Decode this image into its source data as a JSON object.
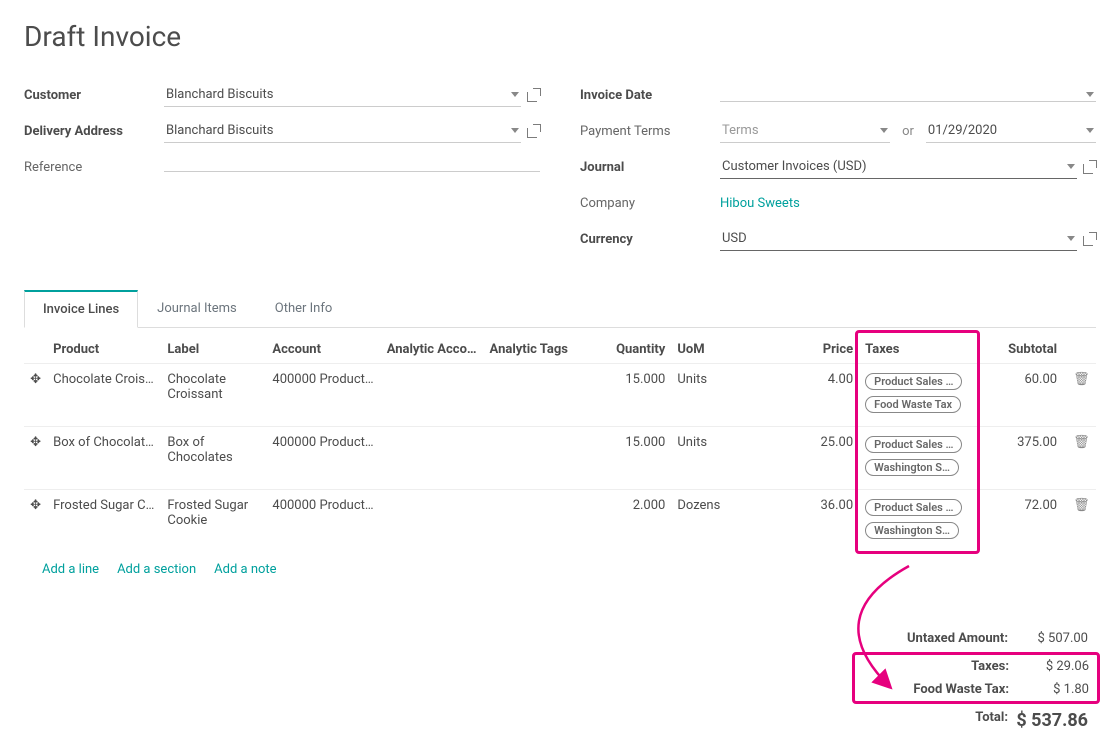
{
  "title": "Draft Invoice",
  "labels": {
    "customer": "Customer",
    "delivery": "Delivery Address",
    "reference": "Reference",
    "invoice_date": "Invoice Date",
    "payment_terms": "Payment Terms",
    "journal": "Journal",
    "company": "Company",
    "currency": "Currency",
    "or": "or"
  },
  "form": {
    "customer": "Blanchard Biscuits",
    "delivery": "Blanchard Biscuits",
    "reference": "",
    "invoice_date": "",
    "terms_placeholder": "Terms",
    "due_date": "01/29/2020",
    "journal": "Customer Invoices (USD)",
    "company": "Hibou Sweets",
    "currency": "USD"
  },
  "tabs": {
    "lines": "Invoice Lines",
    "journal": "Journal Items",
    "other": "Other Info"
  },
  "columns": {
    "product": "Product",
    "label": "Label",
    "account": "Account",
    "analytic_account": "Analytic Acco…",
    "analytic_tags": "Analytic Tags",
    "quantity": "Quantity",
    "uom": "UoM",
    "price": "Price",
    "taxes": "Taxes",
    "subtotal": "Subtotal"
  },
  "lines": [
    {
      "product": "Chocolate Crois…",
      "label": "Chocolate Croissant",
      "account": "400000 Product…",
      "quantity": "15.000",
      "uom": "Units",
      "price": "4.00",
      "taxes": [
        "Product Sales …",
        "Food Waste Tax"
      ],
      "subtotal": "60.00"
    },
    {
      "product": "Box of Chocolat…",
      "label": "Box of Chocolates",
      "account": "400000 Product…",
      "quantity": "15.000",
      "uom": "Units",
      "price": "25.00",
      "taxes": [
        "Product Sales …",
        "Washington S…"
      ],
      "subtotal": "375.00"
    },
    {
      "product": "Frosted Sugar C…",
      "label": "Frosted Sugar Cookie",
      "account": "400000 Product…",
      "quantity": "2.000",
      "uom": "Dozens",
      "price": "36.00",
      "taxes": [
        "Product Sales …",
        "Washington S…"
      ],
      "subtotal": "72.00"
    }
  ],
  "actions": {
    "add_line": "Add a line",
    "add_section": "Add a section",
    "add_note": "Add a note"
  },
  "totals": {
    "untaxed_label": "Untaxed Amount:",
    "untaxed_value": "$ 507.00",
    "taxes_label": "Taxes:",
    "taxes_value": "$ 29.06",
    "food_waste_label": "Food Waste Tax:",
    "food_waste_value": "$ 1.80",
    "total_label": "Total:",
    "total_value": "$ 537.86"
  }
}
